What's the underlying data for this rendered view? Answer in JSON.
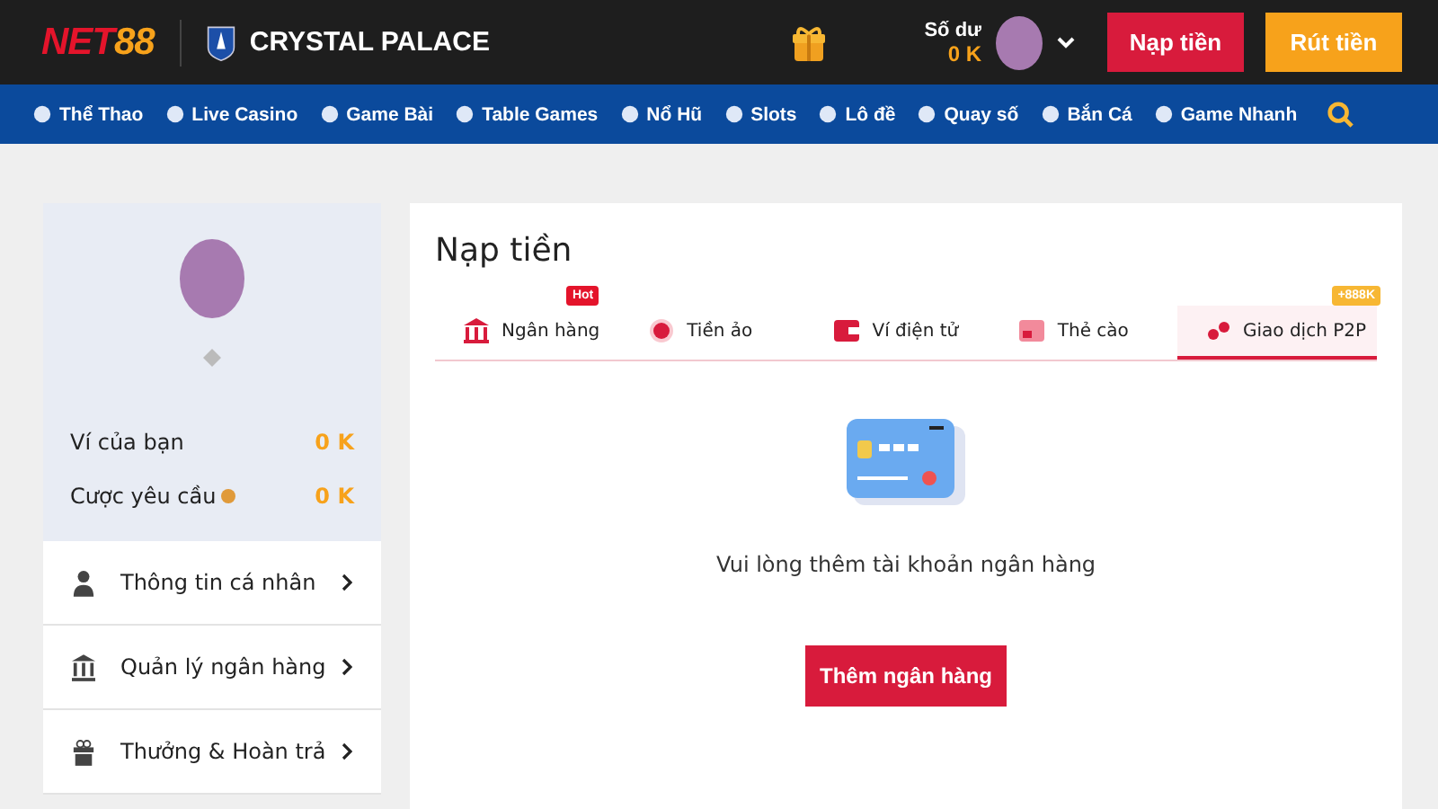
{
  "header": {
    "logo": {
      "first": "NET",
      "second": "88"
    },
    "partner": "CRYSTAL PALACE",
    "balance_label": "Số dư",
    "balance": "0 K",
    "deposit_button": "Nạp tiền",
    "withdraw_button": "Rút tiền"
  },
  "nav": [
    "Thể Thao",
    "Live Casino",
    "Game Bài",
    "Table Games",
    "Nổ Hũ",
    "Slots",
    "Lô đề",
    "Quay số",
    "Bắn Cá",
    "Game Nhanh"
  ],
  "sidebar": {
    "wallet_label": "Ví của bạn",
    "wallet": "0 K",
    "bet_label": "Cược yêu cầu",
    "bet": "0 K",
    "items": [
      {
        "label": "Thông tin cá nhân"
      },
      {
        "label": "Quản lý ngân hàng"
      },
      {
        "label": "Thưởng & Hoàn trả"
      }
    ]
  },
  "main": {
    "title": "Nạp tiền",
    "tabs": [
      {
        "label": "Ngân hàng",
        "selected": false,
        "badge": "Hot"
      },
      {
        "label": "Tiền ảo",
        "selected": false
      },
      {
        "label": "Ví điện tử",
        "selected": false
      },
      {
        "label": "Thẻ cào",
        "selected": false
      },
      {
        "label": "Giao dịch P2P",
        "selected": true,
        "badge": "+888K"
      }
    ],
    "message": "Vui lòng thêm tài khoản ngân hàng",
    "add_button": "Thêm ngân hàng"
  }
}
